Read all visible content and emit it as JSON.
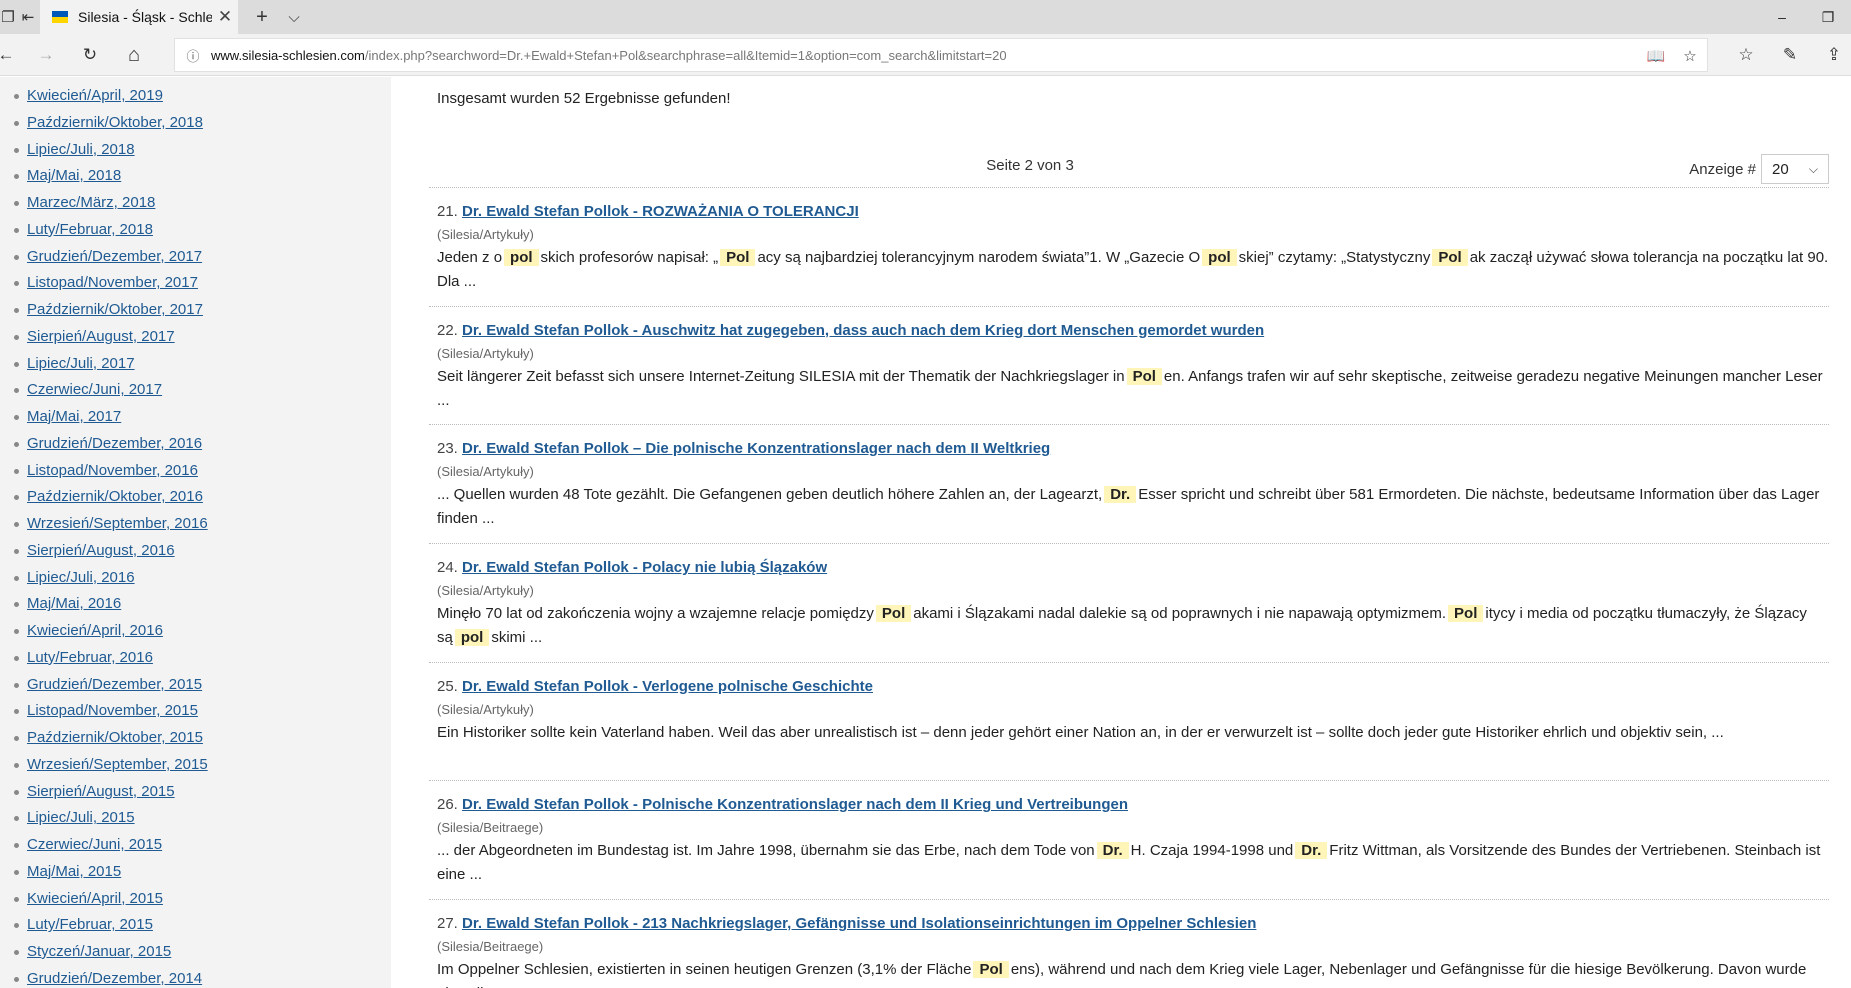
{
  "browser": {
    "tab_title": "Silesia - Śląsk - Schlesie",
    "url_host": "www.silesia-schlesien.com",
    "url_path": "/index.php?searchword=Dr.+Ewald+Stefan+Pol&searchphrase=all&Itemid=1&option=com_search&limitstart=20",
    "icons": {
      "tab_close": "✕",
      "new_tab": "+",
      "tab_list": "⌵",
      "minimize": "–",
      "restore": "❐",
      "back": "←",
      "forward": "→",
      "refresh": "↻",
      "home": "⌂",
      "info": "ⓘ",
      "reading": "📖",
      "favorite": "☆",
      "favorites": "☆",
      "pen": "✎",
      "share": "⇪"
    },
    "flag_colors": [
      "#0057b7",
      "#ffd500"
    ]
  },
  "sidebar": {
    "items": [
      "Kwiecień/April, 2019",
      "Październik/Oktober, 2018",
      "Lipiec/Juli, 2018",
      "Maj/Mai, 2018",
      "Marzec/März, 2018",
      "Luty/Februar, 2018",
      "Grudzień/Dezember, 2017",
      "Listopad/November, 2017",
      "Październik/Oktober, 2017",
      "Sierpień/August, 2017",
      "Lipiec/Juli, 2017",
      "Czerwiec/Juni, 2017",
      "Maj/Mai, 2017",
      "Grudzień/Dezember, 2016",
      "Listopad/November, 2016",
      "Październik/Oktober, 2016",
      "Wrzesień/September, 2016",
      "Sierpień/August, 2016",
      "Lipiec/Juli, 2016",
      "Maj/Mai, 2016",
      "Kwiecień/April, 2016",
      "Luty/Februar, 2016",
      "Grudzień/Dezember, 2015",
      "Listopad/November, 2015",
      "Październik/Oktober, 2015",
      "Wrzesień/September, 2015",
      "Sierpień/August, 2015",
      "Lipiec/Juli, 2015",
      "Czerwiec/Juni, 2015",
      "Maj/Mai, 2015",
      "Kwiecień/April, 2015",
      "Luty/Februar, 2015",
      "Styczeń/Januar, 2015",
      "Grudzień/Dezember, 2014"
    ]
  },
  "search": {
    "summary": "Insgesamt wurden 52 Ergebnisse gefunden!",
    "pager": "Seite 2 von 3",
    "limit_label": "Anzeige #",
    "limit_value": "20"
  },
  "results": [
    {
      "num": "21.",
      "title": "Dr. Ewald Stefan Pollok - ROZWAŻANIA O TOLERANCJI",
      "category": "(Silesia/Artykuły)",
      "segments": [
        {
          "t": "Jeden z o"
        },
        {
          "t": "pol",
          "hl": true
        },
        {
          "t": "skich profesorów napisał: „"
        },
        {
          "t": "Pol",
          "hl": true
        },
        {
          "t": "acy są najbardziej tolerancyjnym narodem świata”1. W „Gazecie O"
        },
        {
          "t": "pol",
          "hl": true
        },
        {
          "t": "skiej” czytamy: „Statystyczny"
        },
        {
          "t": "Pol",
          "hl": true
        },
        {
          "t": "ak zaczął używać słowa tolerancja na początku lat 90. Dla ..."
        }
      ]
    },
    {
      "num": "22.",
      "title": "Dr. Ewald Stefan Pollok - Auschwitz hat zugegeben, dass auch nach dem Krieg dort Menschen gemordet wurden",
      "category": "(Silesia/Artykuły)",
      "segments": [
        {
          "t": "Seit längerer Zeit befasst sich unsere Internet-Zeitung SILESIA mit der Thematik der Nachkriegslager in"
        },
        {
          "t": "Pol",
          "hl": true
        },
        {
          "t": "en. Anfangs trafen wir auf sehr skeptische, zeitweise geradezu negative Meinungen mancher Leser ..."
        }
      ]
    },
    {
      "num": "23.",
      "title": "Dr. Ewald Stefan Pollok – Die polnische Konzentrationslager nach dem II Weltkrieg",
      "category": "(Silesia/Artykuły)",
      "segments": [
        {
          "t": "... Quellen wurden 48 Tote gezählt. Die Gefangenen geben deutlich höhere Zahlen an, der Lagearzt,"
        },
        {
          "t": "Dr.",
          "hl": true
        },
        {
          "t": "Esser spricht und schreibt über 581 Ermordeten. Die nächste, bedeutsame Information über das Lager finden ..."
        }
      ]
    },
    {
      "num": "24.",
      "title": "Dr. Ewald Stefan Pollok - Polacy nie lubią Ślązaków",
      "category": "(Silesia/Artykuły)",
      "segments": [
        {
          "t": "Minęło 70 lat od zakończenia wojny a wzajemne relacje pomiędzy"
        },
        {
          "t": "Pol",
          "hl": true
        },
        {
          "t": "akami i Ślązakami nadal dalekie są od poprawnych i nie napawają optymizmem."
        },
        {
          "t": "Pol",
          "hl": true
        },
        {
          "t": "itycy i media od początku tłumaczyły, że Ślązacy są"
        },
        {
          "t": "pol",
          "hl": true
        },
        {
          "t": "skimi ..."
        }
      ]
    },
    {
      "num": "25.",
      "title": "Dr. Ewald Stefan Pollok - Verlogene polnische Geschichte",
      "category": "(Silesia/Artykuły)",
      "segments": [
        {
          "t": "Ein Historiker sollte kein Vaterland haben. Weil das aber unrealistisch ist – denn jeder gehört einer Nation an, in der er verwurzelt ist – sollte doch jeder gute Historiker ehrlich und objektiv sein, ..."
        }
      ]
    },
    {
      "num": "26.",
      "title": "Dr. Ewald Stefan Pollok - Polnische Konzentrationslager nach dem II Krieg und Vertreibungen",
      "category": "(Silesia/Beitraege)",
      "segments": [
        {
          "t": "... der Abgeordneten im Bundestag ist. Im Jahre 1998, übernahm sie das Erbe, nach dem Tode von"
        },
        {
          "t": "Dr.",
          "hl": true
        },
        {
          "t": "H. Czaja 1994-1998 und"
        },
        {
          "t": "Dr.",
          "hl": true
        },
        {
          "t": "Fritz Wittman, als Vorsitzende des Bundes der Vertriebenen. Steinbach ist eine ..."
        }
      ]
    },
    {
      "num": "27.",
      "title": "Dr. Ewald Stefan Pollok - 213 Nachkriegslager, Gefängnisse und Isolationseinrichtungen im Oppelner Schlesien",
      "category": "(Silesia/Beitraege)",
      "segments": [
        {
          "t": "Im Oppelner Schlesien, existierten in seinen heutigen Grenzen (3,1% der Fläche"
        },
        {
          "t": "Pol",
          "hl": true
        },
        {
          "t": "ens), während und nach dem Krieg viele Lager, Nebenlager und Gefängnisse für die hiesige Bevölkerung. Davon wurde ein Teil ..."
        }
      ]
    }
  ]
}
